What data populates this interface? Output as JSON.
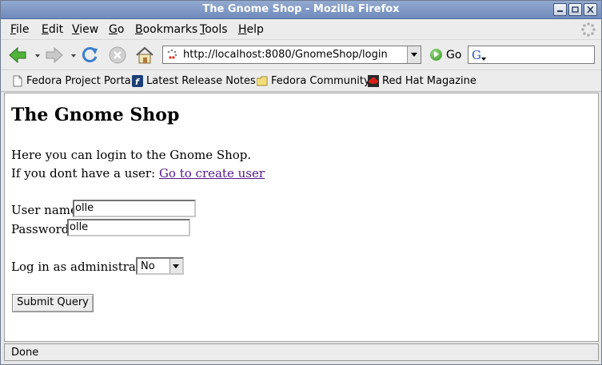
{
  "window": {
    "title": "The Gnome Shop - Mozilla Firefox"
  },
  "menubar": {
    "items": [
      {
        "first": "F",
        "rest": "ile"
      },
      {
        "first": "E",
        "rest": "dit"
      },
      {
        "first": "V",
        "rest": "iew"
      },
      {
        "first": "G",
        "rest": "o"
      },
      {
        "first": "B",
        "rest": "ookmarks"
      },
      {
        "first": "T",
        "rest": "ools"
      },
      {
        "first": "H",
        "rest": "elp"
      }
    ]
  },
  "navbar": {
    "url": "http://localhost:8080/GnomeShop/login",
    "go_label": "Go",
    "search_engine_icon": "google-icon"
  },
  "bookmarks": [
    {
      "label": "Fedora Project Portal",
      "icon": "page-icon"
    },
    {
      "label": "Latest Release Notes",
      "icon": "fedora-icon"
    },
    {
      "label": "Fedora Community",
      "icon": "folder-icon"
    },
    {
      "label": "Red Hat Magazine",
      "icon": "redhat-icon"
    }
  ],
  "page": {
    "heading": "The Gnome Shop",
    "intro": "Here you can login to the Gnome Shop.",
    "no_user_text": "If you dont have a user: ",
    "create_user_link": "Go to create user",
    "username_label": "User name:",
    "username_value": "olle",
    "password_label": "Password:",
    "password_value": "olle",
    "admin_label": "Log in as administrator:",
    "admin_value": "No",
    "submit_label": "Submit Query"
  },
  "status": {
    "text": "Done"
  },
  "colors": {
    "titlebar": "#7d96c4",
    "link": "#551a8b"
  }
}
